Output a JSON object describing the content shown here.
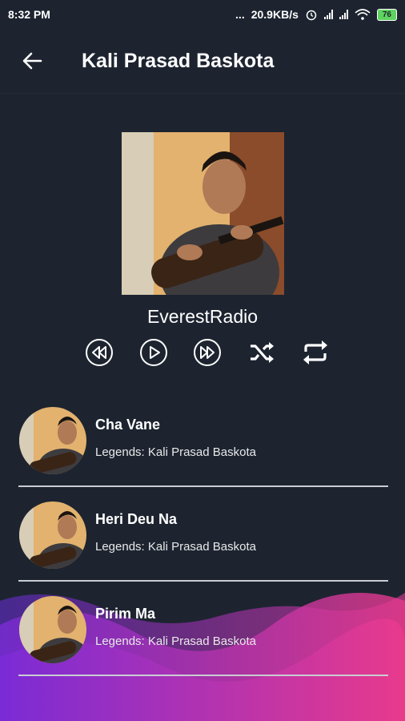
{
  "status_bar": {
    "time": "8:32 PM",
    "dots": "...",
    "network_speed": "20.9KB/s",
    "battery": "76"
  },
  "app_bar": {
    "title": "Kali Prasad Baskota"
  },
  "player": {
    "station": "EverestRadio",
    "controls": [
      "rewind-icon",
      "play-icon",
      "fast-forward-icon",
      "shuffle-icon",
      "repeat-icon"
    ]
  },
  "songs": [
    {
      "title": "Cha Vane",
      "subtitle": "Legends: Kali Prasad Baskota"
    },
    {
      "title": "Heri Deu Na",
      "subtitle": "Legends: Kali Prasad Baskota"
    },
    {
      "title": "Pirim Ma",
      "subtitle": "Legends: Kali Prasad Baskota"
    }
  ],
  "colors": {
    "background": "#1d2430",
    "wave_start": "#7a2bd6",
    "wave_end": "#e83a8c"
  }
}
